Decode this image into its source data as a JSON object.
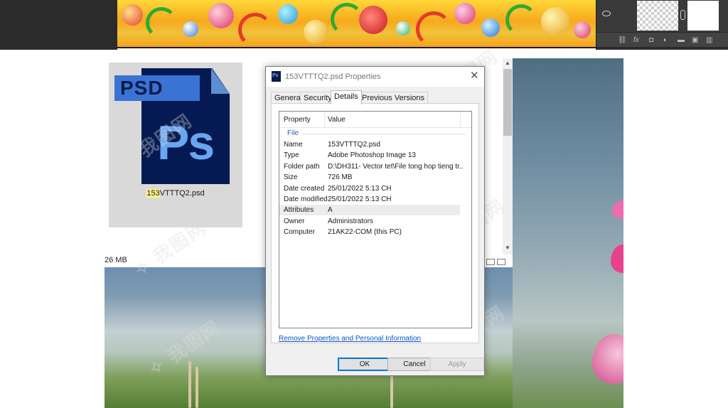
{
  "dialog": {
    "title": "153VTTTQ2.psd Properties",
    "close_glyph": "✕",
    "tabs": [
      {
        "label": "General"
      },
      {
        "label": "Security"
      },
      {
        "label": "Details"
      },
      {
        "label": "Previous Versions"
      }
    ],
    "active_tab": "Details",
    "columns": {
      "property": "Property",
      "value": "Value"
    },
    "group": "File",
    "rows": [
      {
        "property": "Name",
        "value": "153VTTTQ2.psd"
      },
      {
        "property": "Type",
        "value": "Adobe Photoshop Image 13"
      },
      {
        "property": "Folder path",
        "value": "D:\\DH311- Vector tet\\File tong hop tieng tr..."
      },
      {
        "property": "Size",
        "value": "726 MB"
      },
      {
        "property": "Date created",
        "value": "25/01/2022 5:13 CH"
      },
      {
        "property": "Date modified",
        "value": "25/01/2022 5:13 CH"
      },
      {
        "property": "Attributes",
        "value": "A"
      },
      {
        "property": "Owner",
        "value": "Administrators"
      },
      {
        "property": "Computer",
        "value": "21AK22-COM (this PC)"
      }
    ],
    "selected_row": "Attributes",
    "remove_link": "Remove Properties and Personal Information",
    "buttons": {
      "ok": "OK",
      "cancel": "Cancel",
      "apply": "Apply"
    }
  },
  "explorer": {
    "file_icon_band": "PSD",
    "file_icon_glyph": "Ps",
    "file_name_highlight": "153",
    "file_name_rest": "VTTTQ2.psd",
    "size_label": "26 MB"
  },
  "photoshop": {
    "toolbar_icons": [
      "link-icon",
      "fx-icon",
      "mask-icon",
      "adjustment-icon",
      "folder-icon",
      "new-layer-icon",
      "trash-icon"
    ]
  },
  "colors": {
    "accent": "#0078d7",
    "link": "#0b55c6",
    "group_label": "#2a5fb0",
    "ps_dark": "#051a52",
    "ps_light": "#69a6f2"
  }
}
